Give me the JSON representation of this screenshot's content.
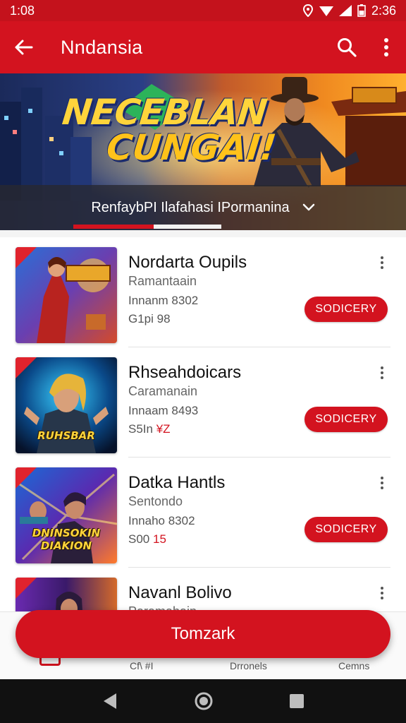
{
  "status_bar": {
    "time_left": "1:08",
    "time_right": "2:36"
  },
  "app_bar": {
    "title": "Nndansia"
  },
  "banner": {
    "headline_line1": "NECEBLAN",
    "headline_line2": "CUNGAI!",
    "sign_text": "",
    "strip_label": "RenfaybPI Ilafahasi IPormanina"
  },
  "games": [
    {
      "title": "Nordarta Oupils",
      "subtitle": "Ramantaain",
      "meta1": "Innanm 8302",
      "meta2_prefix": "G1pi",
      "meta2_value": "98",
      "button": "SODICERY",
      "thumb_caption": "",
      "thumb_badge": ""
    },
    {
      "title": "Rhseahdoicars",
      "subtitle": "Caramanain",
      "meta1": "Innaam 8493",
      "meta2_prefix": "S5In",
      "meta2_value": "¥Z",
      "button": "SODICERY",
      "thumb_caption": "RUHSBAR",
      "thumb_badge": ""
    },
    {
      "title": "Datka Hantls",
      "subtitle": "Sentondo",
      "meta1": "Innaho 8302",
      "meta2_prefix": "S00",
      "meta2_value": "15",
      "button": "SODICERY",
      "thumb_caption": "DNINSOKIN DIAKION",
      "thumb_badge": ""
    },
    {
      "title": "Navanl Bolivo",
      "subtitle": "Paramahain",
      "meta1": "",
      "meta2_prefix": "",
      "meta2_value": "",
      "button": "",
      "thumb_caption": "",
      "thumb_badge": ""
    }
  ],
  "bottom_nav": {
    "item2": "Cf\\ #I",
    "item3": "Drronels",
    "item4": "Cemns"
  },
  "fab": {
    "label": "Tomzark"
  },
  "colors": {
    "primary": "#d3131f",
    "status_bar": "#c4121c"
  }
}
